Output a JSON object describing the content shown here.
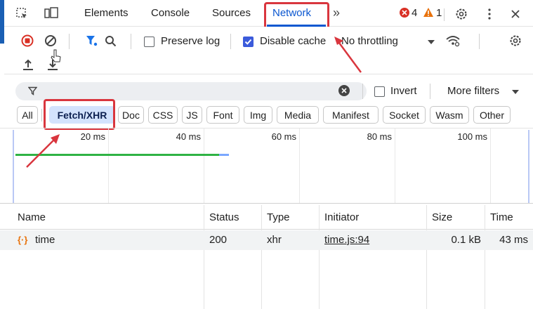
{
  "tabs": {
    "elements": "Elements",
    "console": "Console",
    "sources": "Sources",
    "network": "Network",
    "more": "»",
    "errors_count": "4",
    "warnings_count": "1"
  },
  "toolbar": {
    "preserve_log": "Preserve log",
    "disable_cache": "Disable cache",
    "throttling": "No throttling",
    "preserve_log_checked": false,
    "disable_cache_checked": true
  },
  "filter": {
    "placeholder": "",
    "invert": "Invert",
    "more_filters": "More filters"
  },
  "type_filters": [
    "All",
    "Fetch/XHR",
    "Doc",
    "CSS",
    "JS",
    "Font",
    "Img",
    "Media",
    "Manifest",
    "Socket",
    "Wasm",
    "Other"
  ],
  "type_filters_active": "Fetch/XHR",
  "overview": {
    "ticks": [
      "20 ms",
      "40 ms",
      "60 ms",
      "80 ms",
      "100 ms"
    ]
  },
  "table": {
    "columns": {
      "name": "Name",
      "status": "Status",
      "type": "Type",
      "initiator": "Initiator",
      "size": "Size",
      "time": "Time"
    },
    "rows": [
      {
        "name": "time",
        "status": "200",
        "type": "xhr",
        "initiator": "time.js:94",
        "size": "0.1 kB",
        "time": "43 ms"
      }
    ]
  },
  "colors": {
    "accent": "#0b57d0",
    "annotation_red": "#d9363e",
    "error_red": "#d93025",
    "warning_orange": "#e8710a",
    "waterfall_green": "#2fb344",
    "waterfall_blue": "#7aa7ff"
  }
}
